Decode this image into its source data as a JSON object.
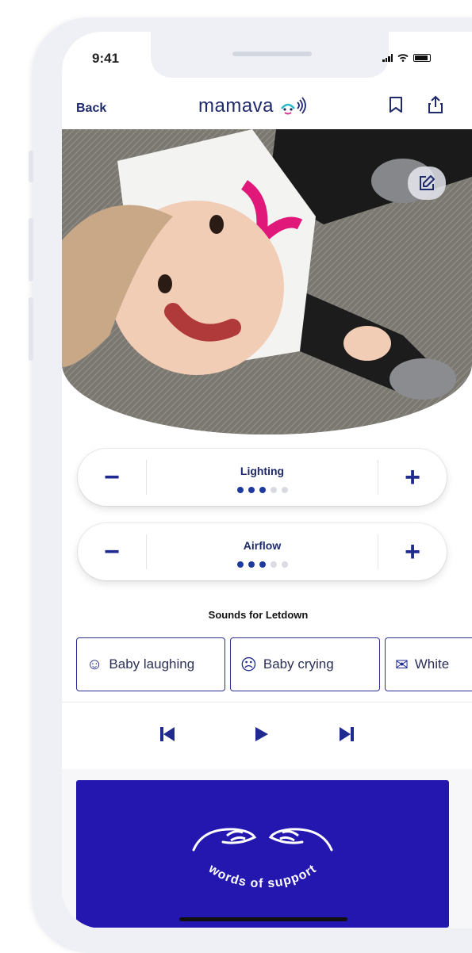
{
  "status": {
    "time": "9:41"
  },
  "nav": {
    "back_label": "Back",
    "logo_text": "mamava"
  },
  "controls": [
    {
      "label": "Lighting",
      "minus": "−",
      "plus": "+",
      "level": 3,
      "max": 5
    },
    {
      "label": "Airflow",
      "minus": "−",
      "plus": "+",
      "level": 3,
      "max": 5
    }
  ],
  "sounds": {
    "title": "Sounds for Letdown",
    "items": [
      {
        "label": "Baby laughing",
        "icon": "laughing-face-icon"
      },
      {
        "label": "Baby crying",
        "icon": "crying-face-icon"
      },
      {
        "label": "White",
        "icon": "white-noise-icon"
      }
    ]
  },
  "player": {
    "prev": "previous-icon",
    "play": "play-icon",
    "next": "next-icon"
  },
  "support": {
    "text": "words of support"
  },
  "colors": {
    "brand": "#1f2a8f",
    "support_bg": "#2317b0",
    "dot_on": "#1f3a9f",
    "dot_off": "#d9dbe2"
  }
}
